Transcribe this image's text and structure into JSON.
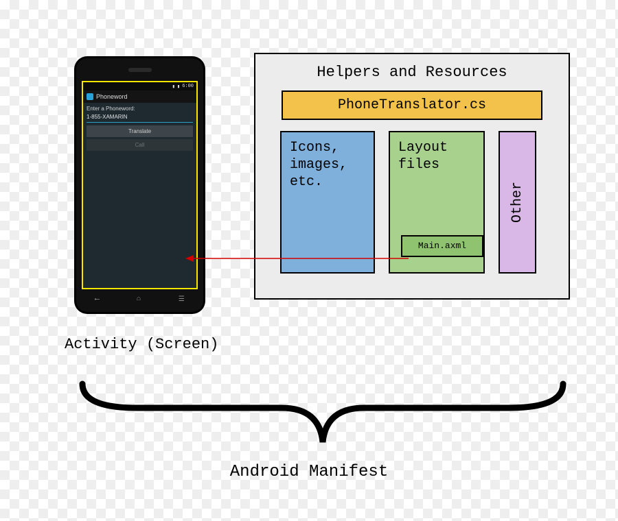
{
  "phone": {
    "status_time": "6:00",
    "app_title": "Phoneword",
    "field_label": "Enter a Phoneword:",
    "field_value": "1-855-XAMARIN",
    "btn_translate": "Translate",
    "btn_call": "Call"
  },
  "panel": {
    "title": "Helpers and Resources",
    "file": "PhoneTranslator.cs",
    "box_icons": "Icons,\nimages,\netc.",
    "box_layout": "Layout\nfiles",
    "layout_file": "Main.axml",
    "box_other": "Other"
  },
  "captions": {
    "activity": "Activity (Screen)",
    "manifest": "Android Manifest"
  }
}
